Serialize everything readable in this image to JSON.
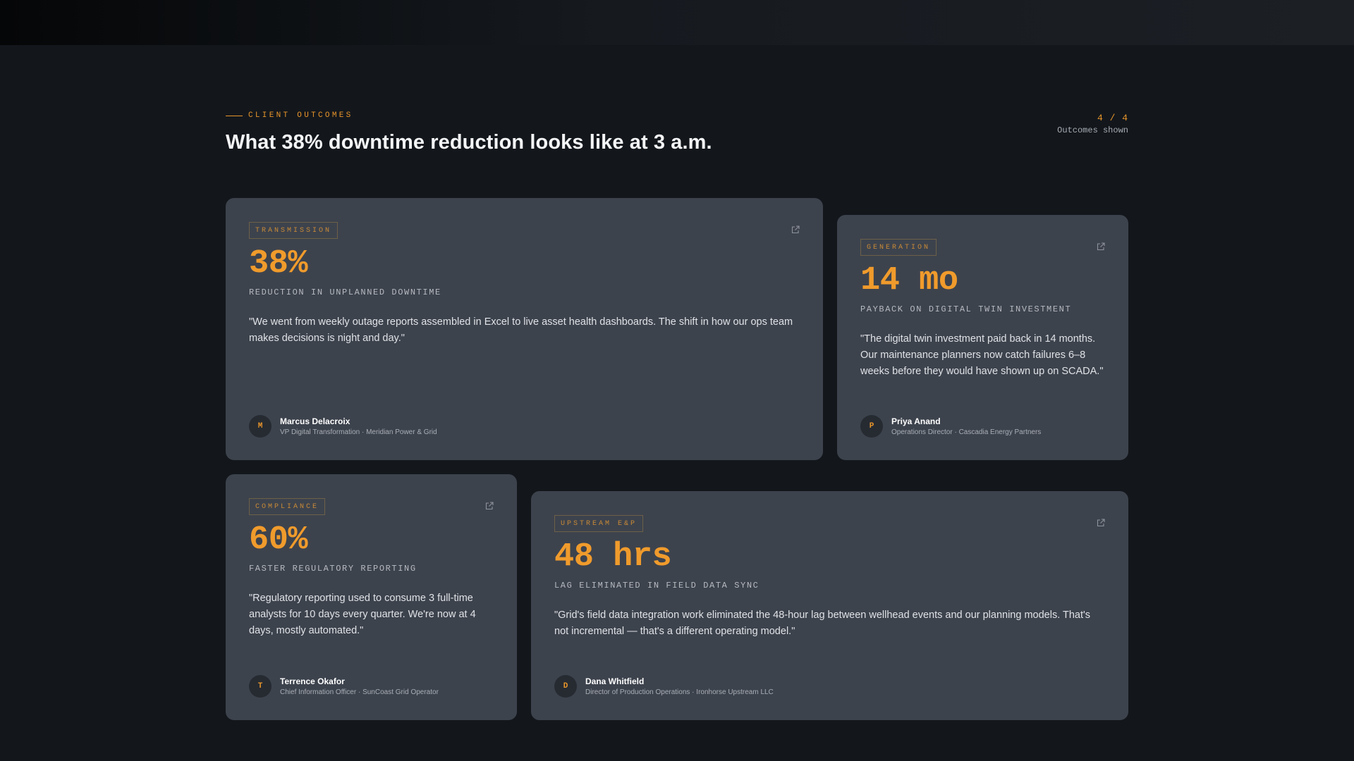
{
  "section": {
    "eyebrow": "CLIENT OUTCOMES",
    "headline": "What 38% downtime reduction looks like at 3 a.m.",
    "counter": "4 / 4",
    "counter_label": "Outcomes shown"
  },
  "colors": {
    "background": "#13171c",
    "card": "#3d434d",
    "accent": "#f09b2c"
  },
  "cards": [
    {
      "tag": "TRANSMISSION",
      "metric": "38%",
      "metric_label": "REDUCTION IN UNPLANNED DOWNTIME",
      "quote": "\"We went from weekly outage reports assembled in Excel to live asset health dashboards. The shift in how our ops team makes decisions is night and day.\"",
      "initial": "M",
      "name": "Marcus Delacroix",
      "role": "VP Digital Transformation · Meridian Power & Grid",
      "icon": "external-link-icon"
    },
    {
      "tag": "GENERATION",
      "metric": "14 mo",
      "metric_label": "PAYBACK ON DIGITAL TWIN INVESTMENT",
      "quote": "\"The digital twin investment paid back in 14 months. Our maintenance planners now catch failures 6–8 weeks before they would have shown up on SCADA.\"",
      "initial": "P",
      "name": "Priya Anand",
      "role": "Operations Director · Cascadia Energy Partners",
      "icon": "external-link-icon"
    },
    {
      "tag": "COMPLIANCE",
      "metric": "60%",
      "metric_label": "FASTER REGULATORY REPORTING",
      "quote": "\"Regulatory reporting used to consume 3 full-time analysts for 10 days every quarter. We're now at 4 days, mostly automated.\"",
      "initial": "T",
      "name": "Terrence Okafor",
      "role": "Chief Information Officer · SunCoast Grid Operator",
      "icon": "external-link-icon"
    },
    {
      "tag": "UPSTREAM E&P",
      "metric": "48 hrs",
      "metric_label": "LAG ELIMINATED IN FIELD DATA SYNC",
      "quote": "\"Grid's field data integration work eliminated the 48-hour lag between wellhead events and our planning models. That's not incremental — that's a different operating model.\"",
      "initial": "D",
      "name": "Dana Whitfield",
      "role": "Director of Production Operations · Ironhorse Upstream LLC",
      "icon": "external-link-icon"
    }
  ]
}
